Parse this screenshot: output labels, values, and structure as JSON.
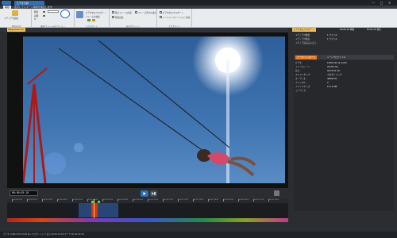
{
  "window": {
    "title": "ビデオ分析",
    "controls": [
      "—",
      "□",
      "✕"
    ]
  },
  "ribbon": {
    "tabs": [
      {
        "label": "開始",
        "active": true
      },
      {
        "label": "表示してイメージ情報を抽出します",
        "active": false
      }
    ],
    "groups": [
      {
        "label": "Media Kit",
        "items": [
          "メディアを追加"
        ]
      },
      {
        "label": "最新/フレームのオプション",
        "items": [
          "数値",
          "詳細",
          "IV",
          "フレームごと"
        ]
      },
      {
        "label": "エクスポート",
        "items": [
          "ビデオをエクスポート",
          "フレームを抽出"
        ]
      },
      {
        "label": "表示オプション",
        "items": [
          "静止フレーム比較",
          "フレーム同士の差分",
          "明度比較"
        ]
      },
      {
        "label": "エクスポート",
        "items": [
          "ビデオをエクスポート",
          "シーンシンプレーション 無効"
        ]
      }
    ]
  },
  "viewer": {
    "file_tab": "Netgame6.mov"
  },
  "transport": {
    "timecode": "00:00:03:18"
  },
  "right_panel": {
    "tabs": [
      "ビデオをエクスポート",
      "Media Kit 情報",
      "Media Kit 補正"
    ],
    "fields": [
      {
        "label": "メディアの数量:",
        "value": "1 ファイル"
      },
      {
        "label": "メディアの総長:",
        "value": "1 ファイル"
      },
      {
        "label": "メディア読み込み 完了:",
        "value": ""
      }
    ],
    "sub_tabs": [
      "データーインポート",
      "シーンプロファイル"
    ],
    "details": [
      {
        "label": "ビデオ:",
        "value": "1280x720 @ 24.00"
      },
      {
        "label": "フレームレート:",
        "value": "29.970 fps"
      },
      {
        "label": "長さ:",
        "value": "00:00:31:18"
      },
      {
        "label": "スキャンタイプ:",
        "value": "プログレッシブ"
      },
      {
        "label": "オーディオ:",
        "value": "48000 Hz"
      },
      {
        "label": "チャンネル:",
        "value": "2"
      },
      {
        "label": "ファイルサイズ:",
        "value": "111.5 MB"
      },
      {
        "label": "コーデック:",
        "value": ""
      }
    ]
  },
  "timeline": {
    "ticks": [
      "00:00:01:00",
      "00:00:02:00",
      "00:00:03:00",
      "00:00:04:00",
      "00:00:05:00",
      "00:00:06:00",
      "00:00:07:00",
      "00:00:08:00",
      "00:00:09:00",
      "00:00:10:00",
      "00:00:11:00",
      "00:00:12:00",
      "00:00:13:00",
      "00:00:14:00",
      "00:00:15:00",
      "00:00:16:00",
      "00:00:17:00",
      "00:00:18:00"
    ]
  },
  "status": {
    "text": "ビデオ 1280x720 23.98 fps  プログレッシブ  長さ 00:00:31:18  マーク 00:00:03:18"
  },
  "colors": {
    "accent": "#2f6fb5",
    "file_tab": "#f0c060",
    "sky": "#3d6fa8"
  }
}
